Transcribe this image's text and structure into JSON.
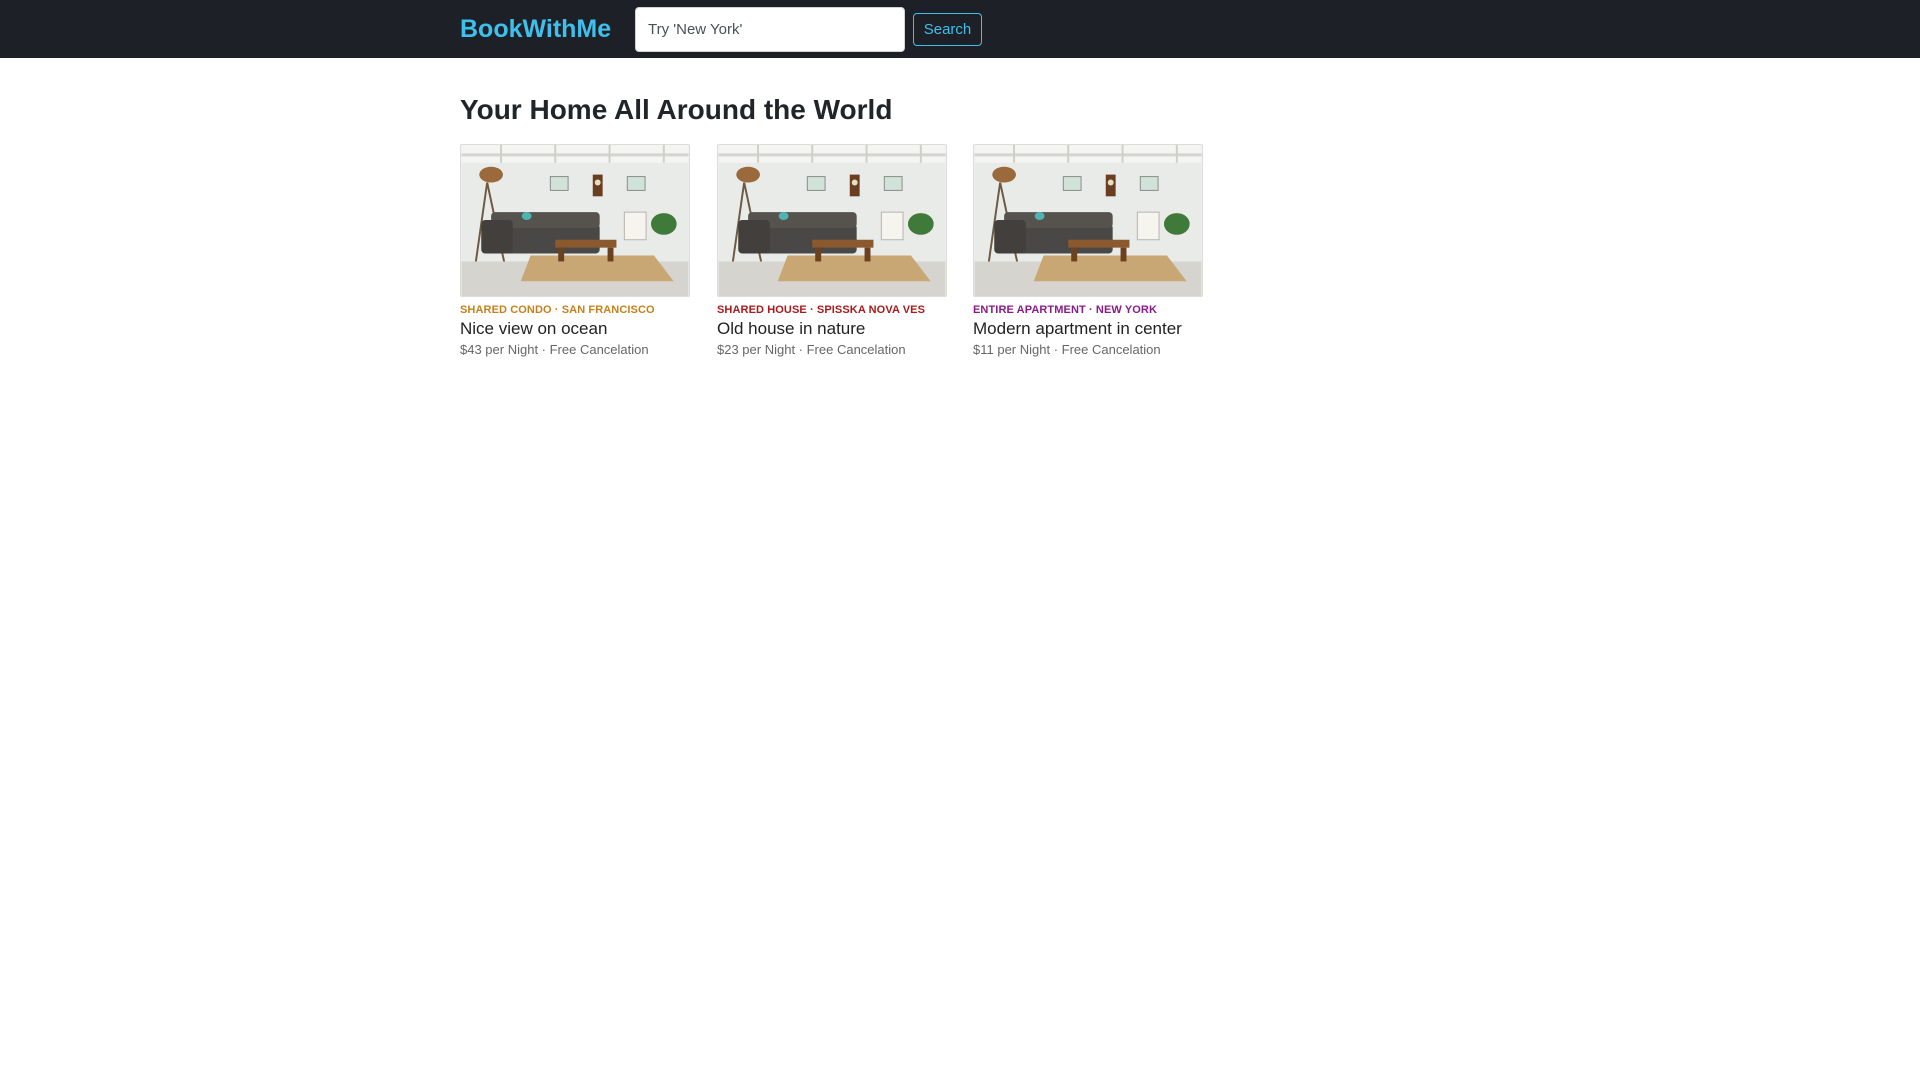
{
  "header": {
    "brand": "BookWithMe",
    "search": {
      "placeholder": "Try 'New York'",
      "value": ""
    },
    "search_button_label": "Search"
  },
  "main": {
    "title": "Your Home All Around the World",
    "listings": [
      {
        "category": "SHARED CONDO · SAN FRANCISCO",
        "category_color": "#c7811c",
        "title": "Nice view on ocean",
        "meta": "$43 per Night · Free Cancelation"
      },
      {
        "category": "SHARED HOUSE · SPISSKA NOVA VES",
        "category_color": "#a91a1a",
        "title": "Old house in nature",
        "meta": "$23 per Night · Free Cancelation"
      },
      {
        "category": "ENTIRE APARTMENT · NEW YORK",
        "category_color": "#8a1b8a",
        "title": "Modern apartment in center",
        "meta": "$11 per Night · Free Cancelation"
      }
    ]
  },
  "colors": {
    "navbar_bg": "#1d2026",
    "accent": "#3fc0ec",
    "text": "#212529"
  },
  "icons": {
    "listing_photo": "living-room-photo"
  }
}
